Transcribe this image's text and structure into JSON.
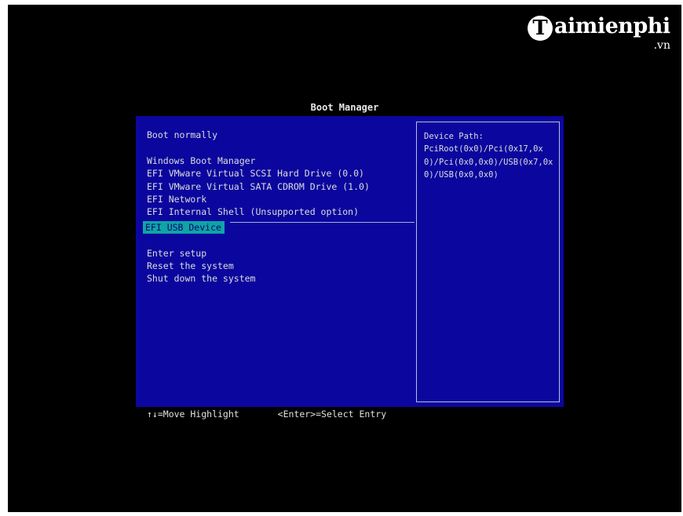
{
  "logo": {
    "mark": "T",
    "name": "aimienphi",
    "tld": ".vn"
  },
  "title": "Boot Manager",
  "menu": {
    "boot_normally": "Boot normally",
    "windows_boot_manager": "Windows Boot Manager",
    "efi_scsi": "EFI VMware Virtual SCSI Hard Drive (0.0)",
    "efi_sata": "EFI VMware Virtual SATA CDROM Drive (1.0)",
    "efi_network": "EFI Network",
    "efi_shell": "EFI Internal Shell (Unsupported option)",
    "efi_usb": "EFI USB Device",
    "enter_setup": "Enter setup",
    "reset_system": "Reset the system",
    "shut_down": "Shut down the system"
  },
  "info": {
    "label": "Device Path:",
    "path": "PciRoot(0x0)/Pci(0x17,0x0)/Pci(0x0,0x0)/USB(0x7,0x0)/USB(0x0,0x0)"
  },
  "footer": {
    "move_hint": "↑↓=Move Highlight",
    "select_hint": "<Enter>=Select Entry"
  },
  "colors": {
    "panel_bg": "#0b079e",
    "highlight": "#10a4a4",
    "text": "#dcdcdc"
  }
}
